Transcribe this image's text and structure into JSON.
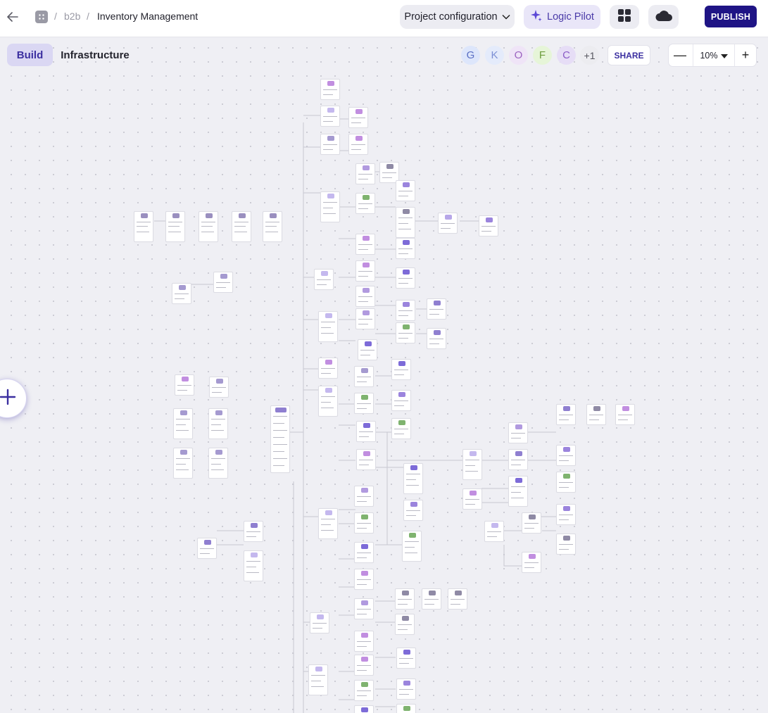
{
  "header": {
    "breadcrumb": [
      "b2b",
      "Inventory Management"
    ],
    "separator": "/",
    "project_config_label": "Project configuration",
    "logic_pilot_label": "Logic Pilot",
    "publish_label": "PUBLISH",
    "icons": [
      "back-arrow-icon",
      "workspace-icon",
      "chevron-down-icon",
      "sparkle-icon",
      "apps-grid-icon",
      "cloud-icon"
    ]
  },
  "toolbar": {
    "tabs": [
      {
        "label": "Build",
        "active": true
      },
      {
        "label": "Infrastructure",
        "active": false
      }
    ],
    "collaborators": [
      {
        "initial": "G",
        "color": "#dde6fb",
        "text_color": "#5a6fc4"
      },
      {
        "initial": "K",
        "color": "#e4ebfb",
        "text_color": "#7c8fd4"
      },
      {
        "initial": "O",
        "color": "#efe4f7",
        "text_color": "#9b62c0"
      },
      {
        "initial": "F",
        "color": "#e6f5d8",
        "text_color": "#6c9d3c"
      },
      {
        "initial": "C",
        "color": "#e6ddf6",
        "text_color": "#8a5cc6"
      }
    ],
    "more_collaborators": "+1",
    "share_label": "SHARE",
    "zoom_value": "10%",
    "zoom_out_symbol": "—",
    "zoom_in_symbol": "+"
  },
  "canvas": {
    "accent": "#3b2fa0",
    "add_button_symbol": "+"
  }
}
